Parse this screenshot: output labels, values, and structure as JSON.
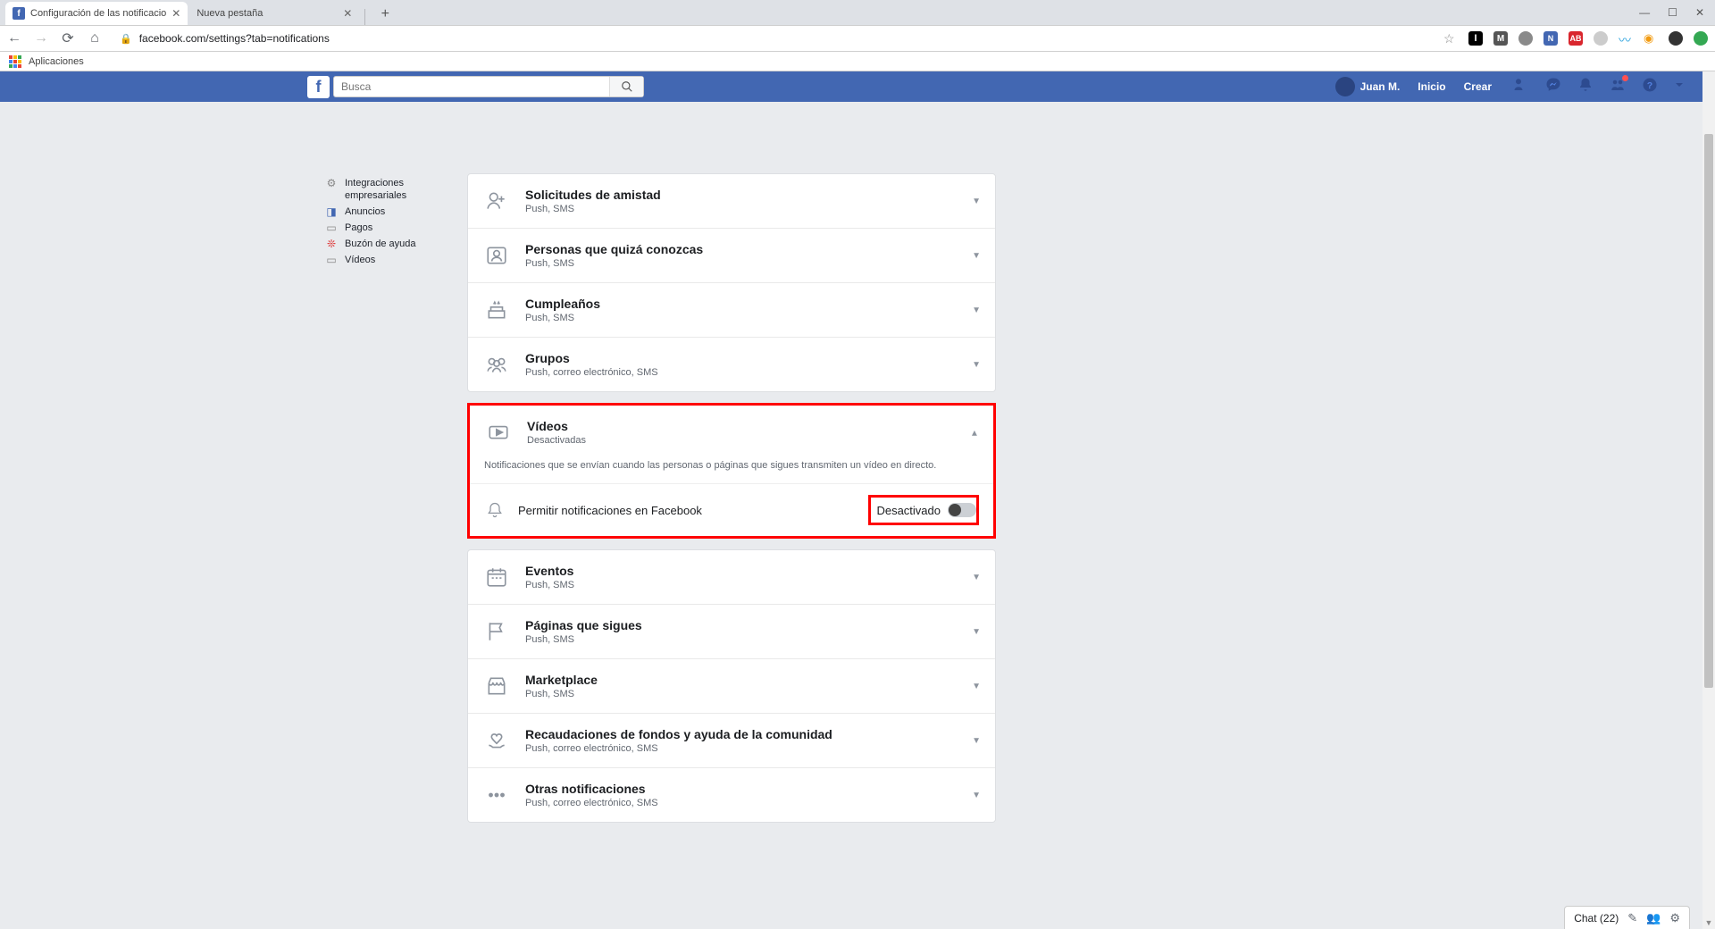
{
  "browser": {
    "tabs": [
      {
        "title": "Configuración de las notificacio",
        "active": true
      },
      {
        "title": "Nueva pestaña",
        "active": false
      }
    ],
    "url": "facebook.com/settings?tab=notifications",
    "bookmark_apps": "Aplicaciones"
  },
  "fb_top": {
    "search_placeholder": "Busca",
    "user_name": "Juan M.",
    "links": {
      "home": "Inicio",
      "create": "Crear"
    }
  },
  "sidebar": {
    "items": [
      {
        "label": "Integraciones empresariales"
      },
      {
        "label": "Anuncios"
      },
      {
        "label": "Pagos"
      },
      {
        "label": "Buzón de ayuda"
      },
      {
        "label": "Vídeos"
      }
    ]
  },
  "rows_top": [
    {
      "title": "Solicitudes de amistad",
      "sub": "Push, SMS"
    },
    {
      "title": "Personas que quizá conozcas",
      "sub": "Push, SMS"
    },
    {
      "title": "Cumpleaños",
      "sub": "Push, SMS"
    },
    {
      "title": "Grupos",
      "sub": "Push, correo electrónico, SMS"
    }
  ],
  "videos": {
    "title": "Vídeos",
    "sub": "Desactivadas",
    "desc": "Notificaciones que se envían cuando las personas o páginas que sigues transmiten un vídeo en directo.",
    "allow_label": "Permitir notificaciones en Facebook",
    "toggle_state": "Desactivado"
  },
  "rows_bot": [
    {
      "title": "Eventos",
      "sub": "Push, SMS"
    },
    {
      "title": "Páginas que sigues",
      "sub": "Push, SMS"
    },
    {
      "title": "Marketplace",
      "sub": "Push, SMS"
    },
    {
      "title": "Recaudaciones de fondos y ayuda de la comunidad",
      "sub": "Push, correo electrónico, SMS"
    },
    {
      "title": "Otras notificaciones",
      "sub": "Push, correo electrónico, SMS"
    }
  ],
  "chat": {
    "label": "Chat (22)"
  }
}
